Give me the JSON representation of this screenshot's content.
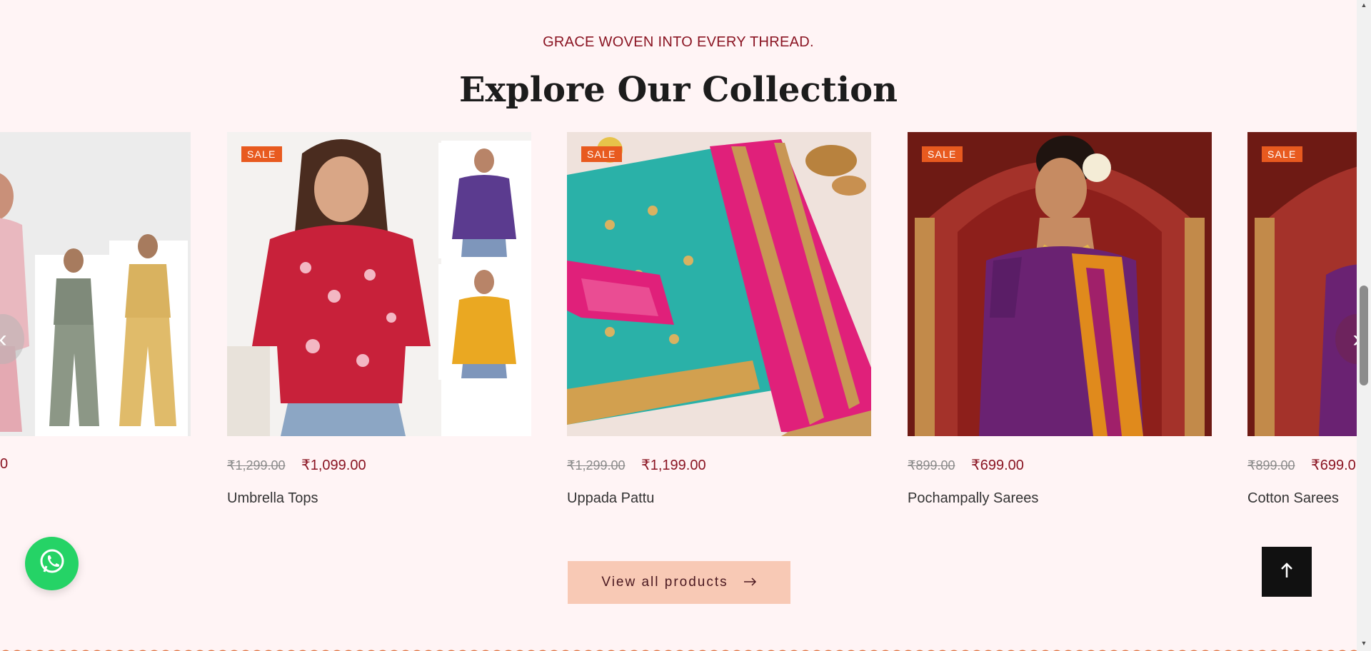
{
  "section": {
    "eyebrow": "GRACE WOVEN INTO EVERY THREAD.",
    "heading": "Explore Our Collection"
  },
  "products": [
    {
      "name": "",
      "sale_badge": "",
      "old_price": "",
      "new_price": "0"
    },
    {
      "name": "Umbrella Tops",
      "sale_badge": "SALE",
      "old_price": "₹1,299.00",
      "new_price": "₹1,099.00"
    },
    {
      "name": "Uppada Pattu",
      "sale_badge": "SALE",
      "old_price": "₹1,299.00",
      "new_price": "₹1,199.00"
    },
    {
      "name": "Pochampally Sarees",
      "sale_badge": "SALE",
      "old_price": "₹899.00",
      "new_price": "₹699.00"
    },
    {
      "name": "Cotton Sarees",
      "sale_badge": "SALE",
      "old_price": "₹899.00",
      "new_price": "₹699.0"
    }
  ],
  "carousel": {
    "prev_icon": "chevron-left-icon",
    "next_icon": "chevron-right-icon"
  },
  "view_all": {
    "label": "View all products",
    "icon": "arrow-right-icon"
  },
  "floating": {
    "whatsapp_icon": "whatsapp-icon",
    "back_to_top_icon": "arrow-up-icon"
  },
  "colors": {
    "background": "#fff4f5",
    "accent": "#8a1422",
    "sale_badge": "#e85a1f",
    "button": "#f8c9b5",
    "whatsapp": "#25d366"
  }
}
